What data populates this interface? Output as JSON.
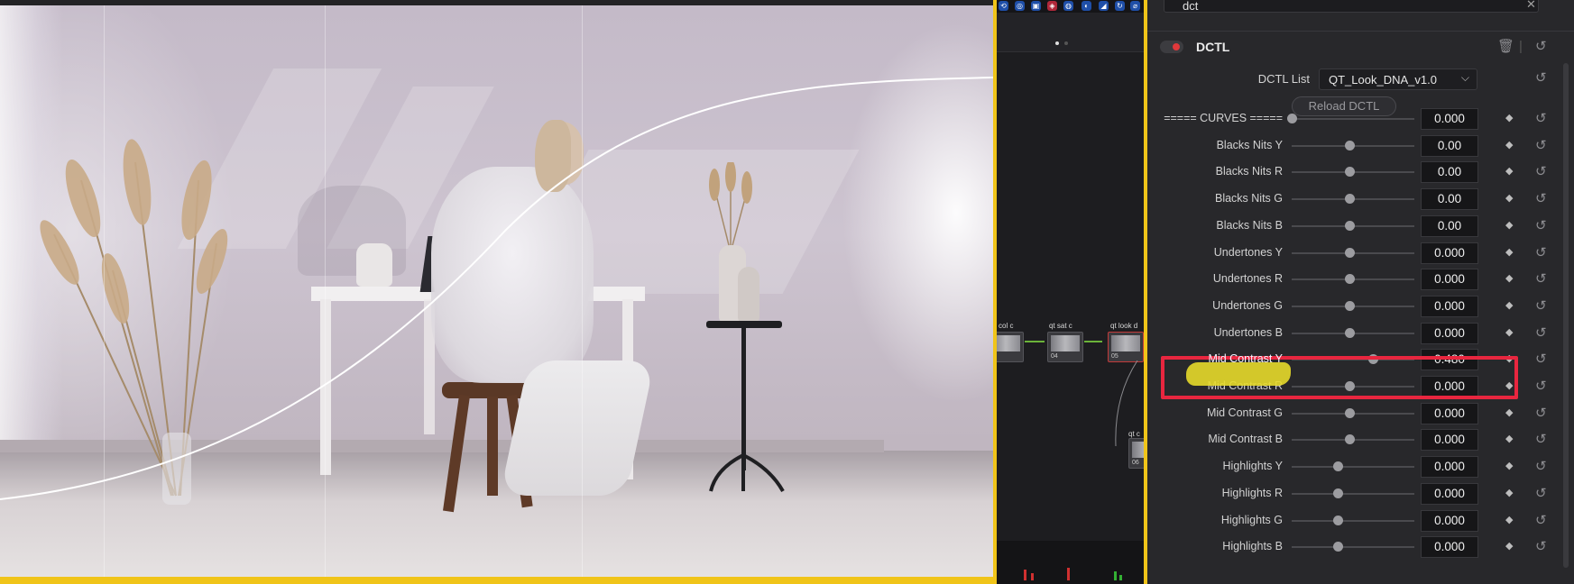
{
  "search": {
    "query": "dct"
  },
  "dctl": {
    "title": "DCTL",
    "list_label": "DCTL List",
    "list_value": "QT_Look_DNA_v1.0",
    "reload_label": "Reload DCTL"
  },
  "params": [
    {
      "label": "===== CURVES =====",
      "value": "0.000",
      "level": 0.0
    },
    {
      "label": "Blacks Nits Y",
      "value": "0.00",
      "level": 0.5
    },
    {
      "label": "Blacks Nits R",
      "value": "0.00",
      "level": 0.5
    },
    {
      "label": "Blacks Nits G",
      "value": "0.00",
      "level": 0.5
    },
    {
      "label": "Blacks Nits B",
      "value": "0.00",
      "level": 0.5
    },
    {
      "label": "Undertones Y",
      "value": "0.000",
      "level": 0.5
    },
    {
      "label": "Undertones R",
      "value": "0.000",
      "level": 0.5
    },
    {
      "label": "Undertones G",
      "value": "0.000",
      "level": 0.5
    },
    {
      "label": "Undertones B",
      "value": "0.000",
      "level": 0.5
    },
    {
      "label": "Mid Contrast Y",
      "value": "0.480",
      "level": 0.7
    },
    {
      "label": "Mid Contrast R",
      "value": "0.000",
      "level": 0.5
    },
    {
      "label": "Mid Contrast G",
      "value": "0.000",
      "level": 0.5
    },
    {
      "label": "Mid Contrast B",
      "value": "0.000",
      "level": 0.5
    },
    {
      "label": "Highlights Y",
      "value": "0.000",
      "level": 0.4
    },
    {
      "label": "Highlights R",
      "value": "0.000",
      "level": 0.4
    },
    {
      "label": "Highlights G",
      "value": "0.000",
      "level": 0.4
    },
    {
      "label": "Highlights B",
      "value": "0.000",
      "level": 0.4
    }
  ],
  "nodes": [
    {
      "label": "col c",
      "num": ""
    },
    {
      "label": "qt sat c",
      "num": "04"
    },
    {
      "label": "qt look d",
      "num": "05"
    },
    {
      "label": "qt c",
      "num": "06"
    }
  ],
  "icons": {
    "delete": "trash-icon",
    "reset": "reset-icon",
    "keyframe": "keyframe-diamond-icon",
    "close": "close-icon",
    "dropdown": "chevron-down-icon"
  },
  "colors": {
    "accent_highlight": "#e8263f",
    "marker": "#e6d92a",
    "viewer_border": "#f0c419",
    "toggle_on": "#e0383b"
  }
}
